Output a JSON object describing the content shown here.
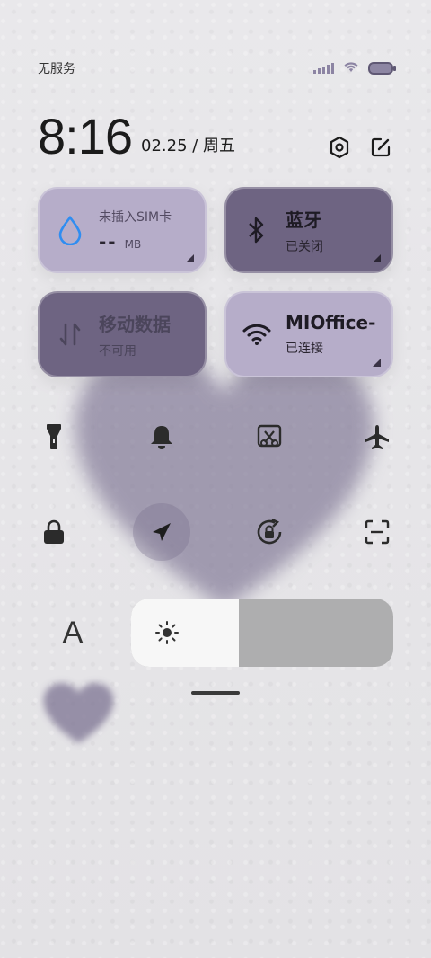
{
  "status_bar": {
    "carrier": "无服务",
    "signal_icon": "signal-bars-icon",
    "wifi_icon": "wifi-icon",
    "battery_icon": "battery-icon"
  },
  "header": {
    "time": "8:16",
    "date": "02.25 / 周五",
    "settings_icon": "settings-icon",
    "edit_icon": "edit-icon"
  },
  "tiles": {
    "sim": {
      "title": "未插入SIM卡",
      "usage": "--",
      "unit": "MB",
      "icon": "water-drop-icon"
    },
    "bluetooth": {
      "title": "蓝牙",
      "status": "已关闭",
      "icon": "bluetooth-icon"
    },
    "mobile_data": {
      "title": "移动数据",
      "status": "不可用",
      "icon": "data-transfer-icon"
    },
    "wifi": {
      "title": "MIOffice-",
      "status": "已连接",
      "icon": "wifi-icon"
    }
  },
  "toggles_row1": [
    {
      "name": "flashlight",
      "icon": "flashlight-icon"
    },
    {
      "name": "bell",
      "icon": "bell-icon"
    },
    {
      "name": "screenshot",
      "icon": "scissors-screenshot-icon"
    },
    {
      "name": "airplane",
      "icon": "airplane-icon"
    }
  ],
  "toggles_row2": [
    {
      "name": "lock",
      "icon": "lock-icon"
    },
    {
      "name": "location",
      "icon": "location-arrow-icon",
      "active": true
    },
    {
      "name": "rotation-lock",
      "icon": "rotation-lock-icon"
    },
    {
      "name": "scanner",
      "icon": "scan-icon"
    }
  ],
  "brightness": {
    "font_glyph": "A",
    "level": 0.41,
    "icon": "sun-icon"
  },
  "colors": {
    "tile_light": "#b6adc9",
    "tile_dark": "#6e6482",
    "accent_blue": "#2f8df1",
    "heart": "#7c7392"
  }
}
